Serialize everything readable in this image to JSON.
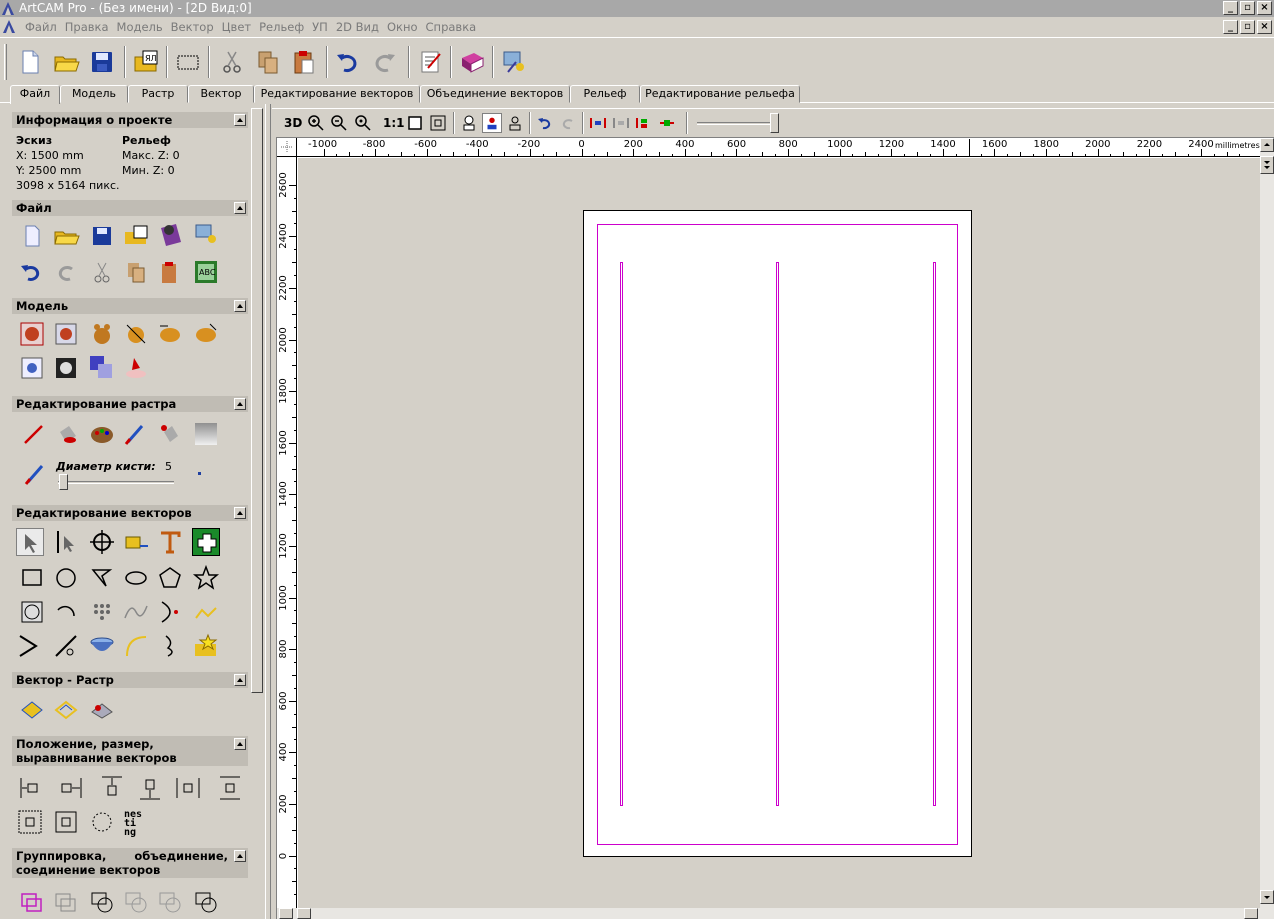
{
  "window": {
    "title": "ArtCAM Pro - (Без имени) - [2D Вид:0]"
  },
  "menu": {
    "items": [
      "Файл",
      "Правка",
      "Модель",
      "Вектор",
      "Цвет",
      "Рельеф",
      "УП",
      "2D Вид",
      "Окно",
      "Справка"
    ]
  },
  "toolbar": {
    "icons": [
      "new-file-icon",
      "open-folder-icon",
      "save-icon",
      "open-image-icon",
      "select-rect-icon",
      "cut-icon",
      "copy-icon",
      "paste-icon",
      "undo-icon",
      "redo-icon",
      "notes-icon",
      "help-book-icon",
      "wizard-icon"
    ]
  },
  "tabs": [
    "Файл",
    "Модель",
    "Растр",
    "Вектор",
    "Редактирование векторов",
    "Объединение векторов",
    "Рельеф",
    "Редактирование рельефа"
  ],
  "active_tab": "Файл",
  "panel": {
    "project_info": {
      "title": "Информация о проекте",
      "sketch_label": "Эскиз",
      "relief_label": "Рельеф",
      "x": "X: 1500 mm",
      "y": "Y: 2500 mm",
      "max_z": "Макс. Z: 0",
      "min_z": "Мин. Z: 0",
      "pixels": "3098 x 5164 пикс."
    },
    "file_title": "Файл",
    "model_title": "Модель",
    "raster_edit_title": "Редактирование растра",
    "brush_label": "Диаметр кисти:",
    "brush_value": "5",
    "vector_edit_title": "Редактирование векторов",
    "vector_raster_title": "Вектор - Растр",
    "position_title": "Положение, размер, выравнивание векторов",
    "group_title": "Группировка, объединение, соединение векторов",
    "nesting_text": "nes ti ng"
  },
  "view": {
    "btn_3d": "3D",
    "btn_11": "1:1",
    "ruler_unit": "millimetres",
    "h_ticks": [
      "-1000",
      "-800",
      "-600",
      "-400",
      "-200",
      "0",
      "200",
      "400",
      "600",
      "800",
      "1000",
      "1200",
      "1400",
      "1600",
      "1800",
      "2000",
      "2200",
      "2400"
    ],
    "v_ticks": [
      "2600",
      "2400",
      "2200",
      "2000",
      "1800",
      "1600",
      "1400",
      "1200",
      "1000",
      "800",
      "600",
      "400",
      "200",
      "0"
    ]
  },
  "colors": {
    "vector": "#cc00cc",
    "background": "#d4d0c8",
    "title_bar": "#a8a8a8"
  }
}
